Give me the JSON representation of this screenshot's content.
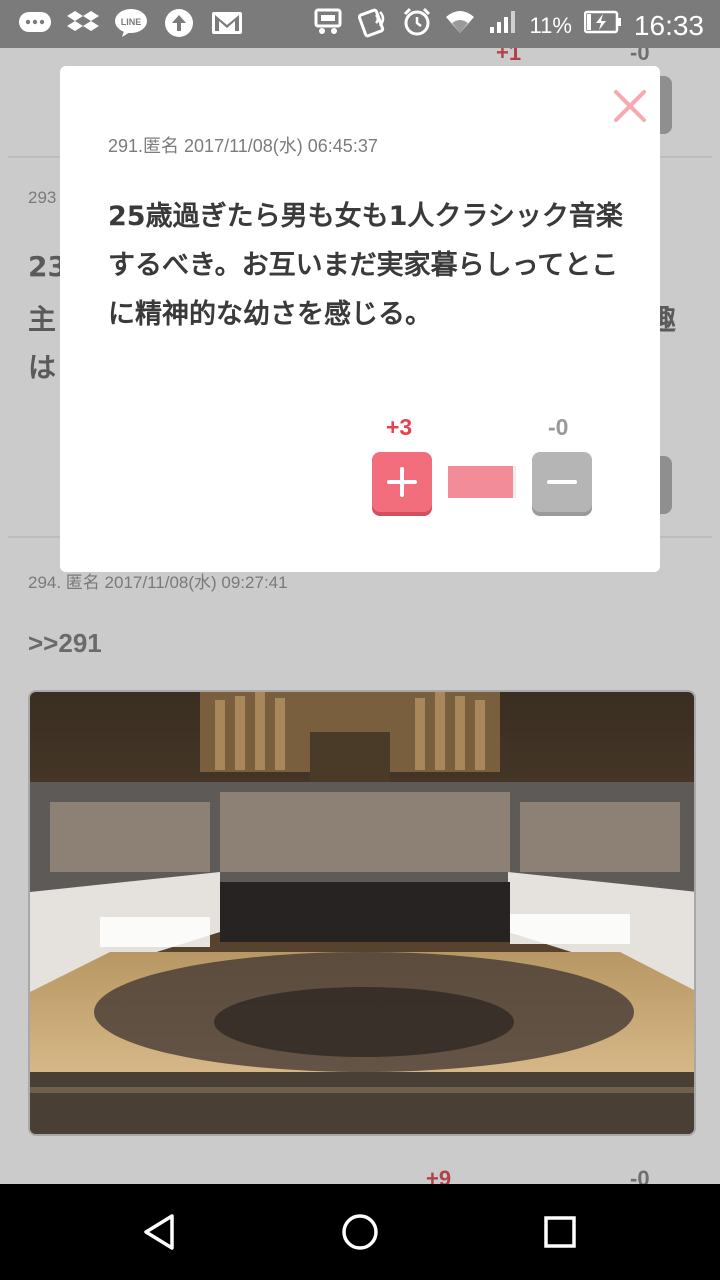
{
  "status_bar": {
    "battery_percent": "11%",
    "time": "16:33",
    "icons": [
      "chat-icon",
      "dropbox-icon",
      "line-icon",
      "upload-icon",
      "gmail-icon",
      "vibrate-icon",
      "nfc-icon",
      "alarm-icon",
      "wifi-icon",
      "signal-icon",
      "battery-charging-icon"
    ]
  },
  "background": {
    "top_post": {
      "plus": "+1",
      "minus": "-0"
    },
    "post_293": {
      "meta": "293",
      "line1": "23",
      "line2_left": "主",
      "line2_right": "趣",
      "line3": "は"
    },
    "post_294": {
      "meta": "294. 匿名 2017/11/08(水) 09:27:41",
      "reply": ">>291"
    },
    "bottom_post": {
      "plus": "+9",
      "minus": "-0"
    }
  },
  "modal": {
    "meta": "291.匿名 2017/11/08(水) 06:45:37",
    "body": "25歳過ぎたら男も女も1人クラシック音楽するべき。お互いまだ実家暮らしってとこに精神的な幼さを感じる。",
    "plus_score": "+3",
    "minus_score": "-0",
    "vote_ratio": 0.95,
    "colors": {
      "plus": "#f26e7c",
      "plus_text": "#e8424f",
      "close": "#f7a8b0"
    }
  },
  "nav": {
    "buttons": [
      "back-icon",
      "home-icon",
      "recents-icon"
    ]
  }
}
